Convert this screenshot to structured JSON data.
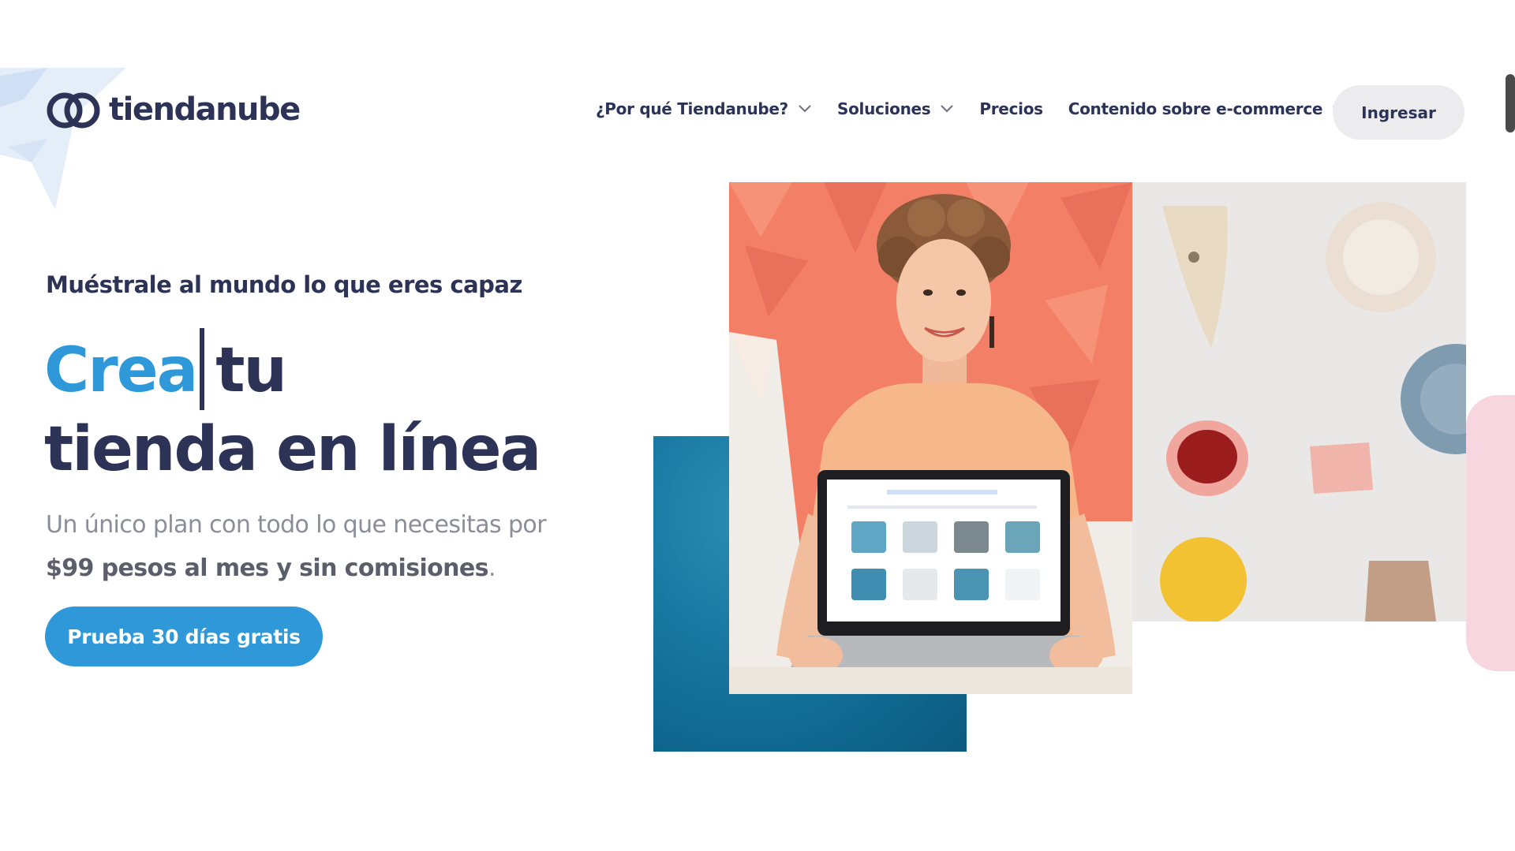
{
  "brand": {
    "name": "tiendanube",
    "colors": {
      "navy": "#2c3357",
      "accent_blue": "#2e98d8",
      "muted_text": "#8b8e99",
      "button_gray": "#ececef"
    }
  },
  "header": {
    "nav": [
      {
        "label": "¿Por qué Tiendanube?",
        "has_dropdown": true,
        "icon": "chevron-down-icon"
      },
      {
        "label": "Soluciones",
        "has_dropdown": true,
        "icon": "chevron-down-icon"
      },
      {
        "label": "Precios",
        "has_dropdown": false
      },
      {
        "label": "Contenido sobre e-commerce",
        "has_dropdown": true,
        "icon": "chevron-down-icon"
      }
    ],
    "login_label": "Ingresar"
  },
  "hero": {
    "eyebrow": "Muéstrale al mundo lo que eres capaz",
    "headline_typed": "Crea",
    "headline_rest_line1": "tu",
    "headline_line2": "tienda en línea",
    "subtext_line1": "Un único plan con todo lo que necesitas por",
    "subtext_strong": "$99 pesos al mes y sin comisiones",
    "subtext_end": ".",
    "cta_label": "Prueba 30 días gratis"
  }
}
